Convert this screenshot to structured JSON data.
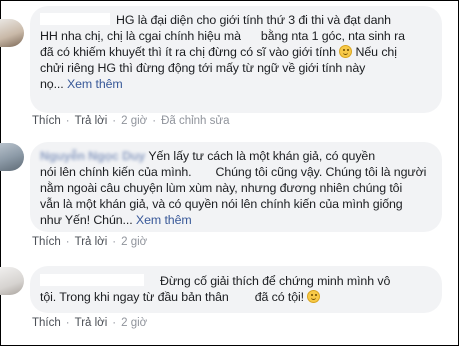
{
  "comments": [
    {
      "lines": [
        "HG là đại diện cho giới tính thứ 3 đi thi và đạt danh",
        "HH nha chị, chị là cgai chính hiệu mà",
        "bằng nta 1 góc, nta sinh ra",
        "đã có khiếm khuyết thì ít ra chị đừng có sĩ vào giới tính",
        "Nếu chị",
        "chửi riêng HG thì đừng động tới mấy từ ngữ về giới tính này",
        "nọ...",
        "Xem thêm"
      ],
      "actions": {
        "like": "Thích",
        "reply": "Trả lời",
        "time": "2 giờ",
        "edited": "Đã chỉnh sửa"
      }
    },
    {
      "name": "Nguyễn Ngọc Duy",
      "lines": [
        "Yến lấy tư cách là một khán giả, có quyền",
        "nói lên chính kiến của mình.",
        "Chúng tôi cũng vậy. Chúng tôi là người",
        "nằm ngoài câu chuyện lùm xùm này, nhưng đương nhiên chúng tôi",
        "vẫn là một khán giả, và có quyền nói lên chính kiến của mình giống",
        "như Yến! Chún...",
        "Xem thêm"
      ],
      "actions": {
        "like": "Thích",
        "reply": "Trả lời",
        "time": "2 giờ"
      }
    },
    {
      "lines": [
        "Đừng cố giải thích để chứng minh mình vô",
        "tội. Trong khi ngay từ đầu bản thân",
        "đã có tội!"
      ],
      "actions": {
        "like": "Thích",
        "reply": "Trả lời",
        "time": "2 giờ"
      }
    }
  ],
  "colors": {
    "bubble": "#f2f3f5",
    "link": "#385898",
    "meta": "#90949c",
    "text": "#1c1e21"
  },
  "icons": [
    "smile-emoji-icon"
  ]
}
